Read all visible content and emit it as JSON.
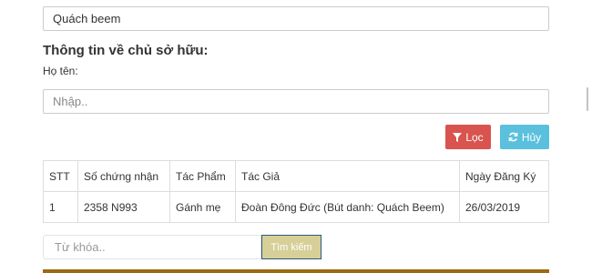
{
  "author_field": {
    "value": "Quách beem"
  },
  "owner_section": {
    "title": "Thông tin về chủ sở hữu:",
    "name_label": "Họ tên:",
    "name_placeholder": "Nhập.."
  },
  "actions": {
    "filter_label": "Lọc",
    "cancel_label": "Hủy",
    "filter_icon": "filter-icon",
    "cancel_icon": "refresh-icon"
  },
  "table": {
    "headers": [
      "STT",
      "Số chứng nhận",
      "Tác Phẩm",
      "Tác Giả",
      "Ngày Đăng Ký"
    ],
    "rows": [
      [
        "1",
        "2358 N993",
        "Gánh mẹ",
        "Đoàn Đông Đức (Bút danh: Quách Beem)",
        "26/03/2019"
      ]
    ]
  },
  "search": {
    "placeholder": "Từ khóa..",
    "button_label": "Tìm kiếm"
  },
  "colors": {
    "filter_button": "#d9534f",
    "cancel_button": "#5bc0de",
    "search_button": "#d6cf98",
    "bottom_bar": "#9c6a12"
  }
}
